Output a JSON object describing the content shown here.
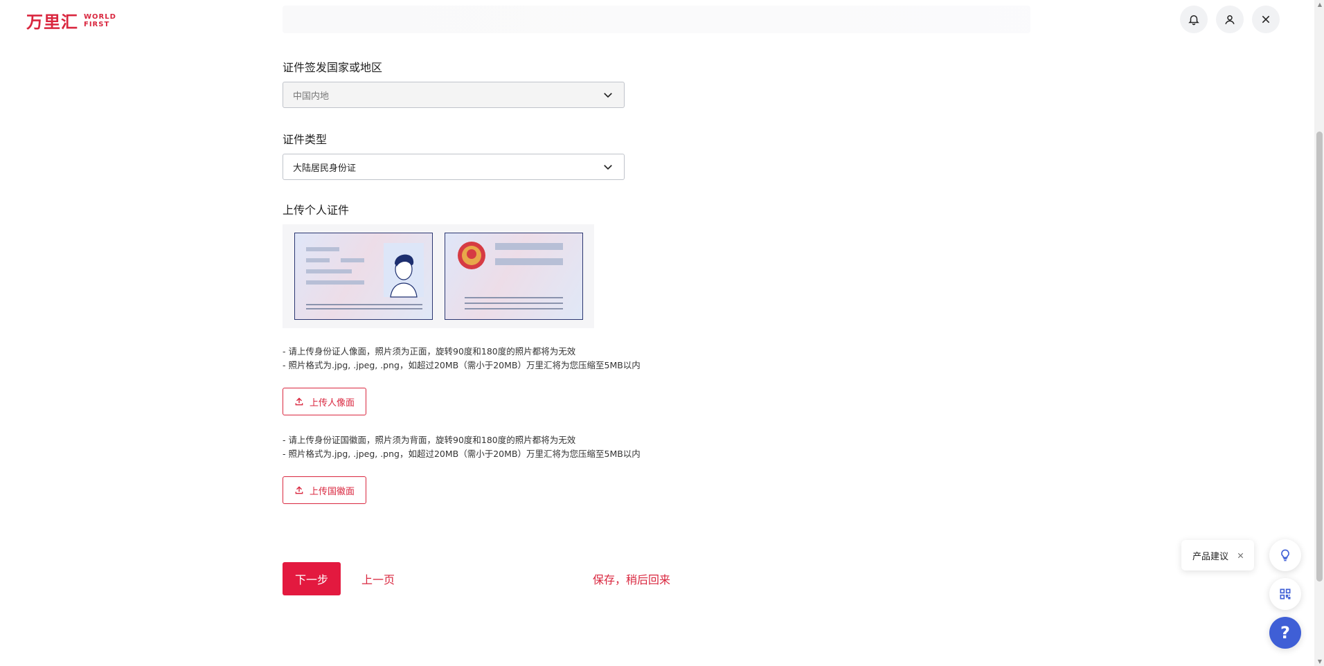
{
  "brand": {
    "logo_cn": "万里汇",
    "logo_en_line1": "WORLD",
    "logo_en_line2": "FIRST",
    "accent_color": "#e3193f"
  },
  "header_icons": [
    "bell-icon",
    "user-icon",
    "close-icon"
  ],
  "form": {
    "country": {
      "label": "证件签发国家或地区",
      "value": "中国内地"
    },
    "id_type": {
      "label": "证件类型",
      "value": "大陆居民身份证"
    },
    "upload": {
      "label": "上传个人证件",
      "portrait": {
        "note1": "- 请上传身份证人像面，照片须为正面，旋转90度和180度的照片都将为无效",
        "note2": "- 照片格式为.jpg, .jpeg, .png，如超过20MB（需小于20MB）万里汇将为您压缩至5MB以内",
        "button": "上传人像面"
      },
      "emblem": {
        "note1": "- 请上传身份证国徽面，照片须为背面，旋转90度和180度的照片都将为无效",
        "note2": "- 照片格式为.jpg, .jpeg, .png，如超过20MB（需小于20MB）万里汇将为您压缩至5MB以内",
        "button": "上传国徽面"
      }
    }
  },
  "actions": {
    "next": "下一步",
    "prev": "上一页",
    "save": "保存，稍后回来"
  },
  "widgets": {
    "suggestion": "产品建议",
    "help": "?"
  }
}
